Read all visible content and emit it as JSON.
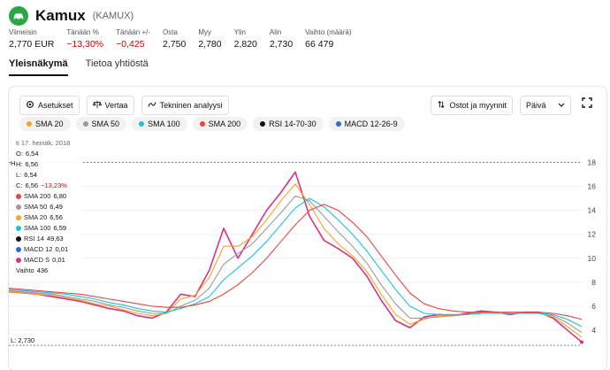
{
  "header": {
    "name": "Kamux",
    "ticker": "(KAMUX)"
  },
  "stats": [
    {
      "label": "Viimeisin",
      "value": "2,770 EUR",
      "negative": false
    },
    {
      "label": "Tänään %",
      "value": "−13,30%",
      "negative": true
    },
    {
      "label": "Tänään +/-",
      "value": "−0,425",
      "negative": true
    },
    {
      "label": "Osta",
      "value": "2,750",
      "negative": false
    },
    {
      "label": "Myy",
      "value": "2,780",
      "negative": false
    },
    {
      "label": "Ylin",
      "value": "2,820",
      "negative": false
    },
    {
      "label": "Alin",
      "value": "2,730",
      "negative": false
    },
    {
      "label": "Vaihto (määrä)",
      "value": "66 479",
      "negative": false
    }
  ],
  "tabs": [
    {
      "label": "Yleisnäkymä",
      "active": true
    },
    {
      "label": "Tietoa yhtiöstä",
      "active": false
    }
  ],
  "toolbar": {
    "settings_label": "Asetukset",
    "compare_label": "Vertaa",
    "technical_label": "Tekninen analyysi",
    "trades_label": "Ostot ja myynnit",
    "period_value": "Päivä"
  },
  "indicators": [
    {
      "label": "SMA 20",
      "color": "#f5a623"
    },
    {
      "label": "SMA 50",
      "color": "#9b9b9b"
    },
    {
      "label": "SMA 100",
      "color": "#1fbfe0"
    },
    {
      "label": "SMA 200",
      "color": "#e8463d"
    },
    {
      "label": "RSI 14-70-30",
      "color": "#111111"
    },
    {
      "label": "MACD 12-26-9",
      "color": "#3367d6"
    }
  ],
  "tooltip": {
    "date": "ti 17. heinäk. 2018",
    "rows": [
      {
        "k": "O:",
        "v": "6,54",
        "color": null
      },
      {
        "k": "H:",
        "v": "6,56",
        "color": null
      },
      {
        "k": "L:",
        "v": "6,54",
        "color": null
      },
      {
        "k": "C:",
        "v": "6,56",
        "extra": "−13,23%",
        "color": null
      },
      {
        "k": "SMA 200",
        "v": "6,80",
        "color": "#e8463d"
      },
      {
        "k": "SMA 50",
        "v": "6,49",
        "color": "#9b9b9b"
      },
      {
        "k": "SMA 20",
        "v": "6,56",
        "color": "#f5a623"
      },
      {
        "k": "SMA 100",
        "v": "6,59",
        "color": "#1fbfe0"
      },
      {
        "k": "RSI 14",
        "v": "49,63",
        "color": "#111111"
      },
      {
        "k": "MACD 12",
        "v": "0,01",
        "color": "#3367d6"
      },
      {
        "k": "MACD S",
        "v": "0,01",
        "color": "#d63384"
      },
      {
        "k": "Vaihto",
        "v": "436",
        "color": null
      }
    ]
  },
  "high_marker": "H",
  "low_marker": "L: 2,730",
  "chart_data": {
    "type": "line",
    "ylim": [
      2,
      19
    ],
    "yticks": [
      4,
      6,
      8,
      10,
      12,
      14,
      16,
      18
    ],
    "high_line": 18,
    "low_line": 2.73,
    "x": [
      0,
      5,
      10,
      15,
      20,
      25,
      30,
      35,
      40,
      45,
      50,
      55,
      60,
      65,
      70,
      75,
      80,
      85,
      90,
      95,
      100,
      105,
      110,
      115,
      120,
      125,
      130,
      135,
      140,
      145,
      150,
      155,
      160,
      165,
      170,
      175,
      180,
      185,
      190,
      195,
      200
    ],
    "series": [
      {
        "name": "Close",
        "color": "#d63384",
        "values": [
          7.2,
          7.1,
          7.0,
          6.8,
          6.6,
          6.4,
          6.1,
          5.8,
          5.6,
          5.2,
          5.0,
          5.5,
          7.0,
          6.8,
          9.0,
          12.5,
          10.0,
          12.0,
          14.0,
          15.5,
          17.2,
          13.5,
          11.5,
          10.8,
          10.0,
          8.5,
          6.5,
          4.8,
          4.2,
          5.1,
          5.3,
          5.2,
          5.4,
          5.6,
          5.5,
          5.3,
          5.5,
          5.5,
          5.0,
          4.0,
          3.0
        ]
      },
      {
        "name": "SMA 20",
        "color": "#f5a623",
        "values": [
          7.2,
          7.1,
          7.0,
          6.9,
          6.7,
          6.5,
          6.2,
          6.0,
          5.7,
          5.4,
          5.2,
          5.4,
          6.6,
          6.9,
          8.4,
          11.0,
          11.0,
          11.8,
          13.2,
          14.8,
          16.2,
          14.5,
          12.5,
          11.2,
          10.2,
          8.9,
          7.0,
          5.3,
          4.5,
          4.9,
          5.2,
          5.2,
          5.3,
          5.5,
          5.5,
          5.4,
          5.4,
          5.4,
          5.1,
          4.3,
          3.4
        ]
      },
      {
        "name": "SMA 50",
        "color": "#9b9b9b",
        "values": [
          7.3,
          7.2,
          7.1,
          7.0,
          6.8,
          6.6,
          6.4,
          6.1,
          5.9,
          5.6,
          5.4,
          5.4,
          6.0,
          6.5,
          7.5,
          9.5,
          10.4,
          11.2,
          12.5,
          13.8,
          15.2,
          14.8,
          13.5,
          12.2,
          11.0,
          9.6,
          7.8,
          6.2,
          5.0,
          5.0,
          5.1,
          5.2,
          5.3,
          5.4,
          5.4,
          5.4,
          5.4,
          5.4,
          5.2,
          4.6,
          3.8
        ]
      },
      {
        "name": "SMA 100",
        "color": "#1fbfe0",
        "values": [
          7.4,
          7.3,
          7.2,
          7.1,
          7.0,
          6.8,
          6.6,
          6.3,
          6.1,
          5.8,
          5.6,
          5.5,
          5.8,
          6.2,
          6.8,
          8.2,
          9.2,
          10.2,
          11.4,
          12.8,
          14.2,
          15.0,
          14.3,
          13.2,
          12.0,
          10.6,
          9.0,
          7.4,
          6.0,
          5.4,
          5.3,
          5.3,
          5.3,
          5.4,
          5.4,
          5.4,
          5.4,
          5.4,
          5.3,
          4.9,
          4.3
        ]
      },
      {
        "name": "SMA 200",
        "color": "#e8463d",
        "values": [
          7.5,
          7.4,
          7.3,
          7.2,
          7.1,
          7.0,
          6.8,
          6.6,
          6.4,
          6.2,
          6.0,
          5.9,
          5.9,
          6.1,
          6.4,
          7.0,
          7.8,
          8.8,
          10.0,
          11.4,
          12.8,
          14.0,
          14.5,
          14.0,
          13.0,
          11.8,
          10.2,
          8.6,
          7.1,
          6.2,
          5.8,
          5.6,
          5.5,
          5.5,
          5.5,
          5.5,
          5.5,
          5.5,
          5.4,
          5.2,
          4.9
        ]
      }
    ]
  }
}
